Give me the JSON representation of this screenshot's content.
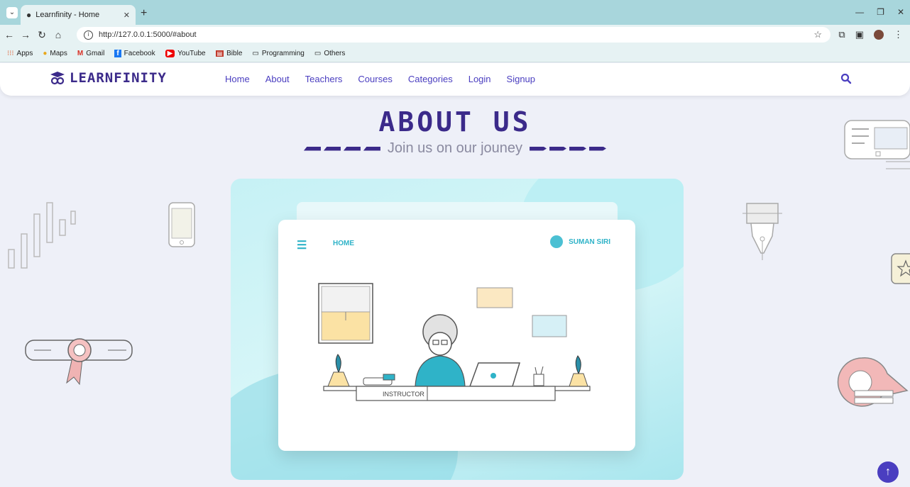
{
  "browser": {
    "tab_title": "Learnfinity - Home",
    "new_tab": "+",
    "url": "http://127.0.0.1:5000/#about",
    "bookmarks": [
      "Apps",
      "Maps",
      "Gmail",
      "Facebook",
      "YouTube",
      "Bible",
      "Programming",
      "Others"
    ]
  },
  "site": {
    "logo": "LEARNFINITY",
    "nav": [
      "Home",
      "About",
      "Teachers",
      "Courses",
      "Categories",
      "Login",
      "Signup"
    ]
  },
  "about": {
    "title": "ABOUT US",
    "subtitle": "Join us on our jouney"
  },
  "illustration": {
    "home_label": "HOME",
    "user_name": "SUMAN SIRI",
    "desk_label": "INSTRUCTOR"
  },
  "colors": {
    "brand": "#3b2a8a",
    "accent": "#4a3ec0",
    "teal": "#2fb3c8"
  }
}
